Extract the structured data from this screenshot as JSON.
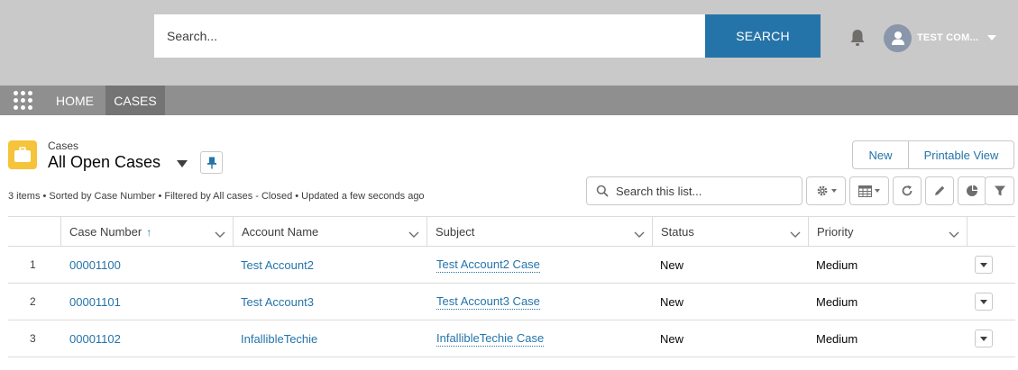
{
  "header": {
    "search_placeholder": "Search...",
    "search_button": "SEARCH",
    "user_name": "TEST COM...",
    "icons": {
      "notifications": "bell-icon",
      "avatar": "user-avatar-icon",
      "user_menu": "chevron-down-icon"
    }
  },
  "nav": {
    "launcher_icon": "app-launcher-icon",
    "items": [
      {
        "label": "HOME",
        "active": false
      },
      {
        "label": "CASES",
        "active": true
      }
    ]
  },
  "list": {
    "object_label": "Cases",
    "view_name": "All Open Cases",
    "meta": "3 items • Sorted by Case Number • Filtered by All cases - Closed • Updated a few seconds ago",
    "actions": {
      "new": "New",
      "printable_view": "Printable View"
    },
    "search_placeholder": "Search this list...",
    "toolbar_icons": [
      "settings-icon",
      "table-view-icon",
      "refresh-icon",
      "edit-icon",
      "chart-icon",
      "filter-icon"
    ]
  },
  "table": {
    "columns": [
      {
        "label": "Case Number",
        "sorted": "ascending"
      },
      {
        "label": "Account Name"
      },
      {
        "label": "Subject"
      },
      {
        "label": "Status"
      },
      {
        "label": "Priority"
      }
    ],
    "rows": [
      {
        "num": "1",
        "case_number": "00001100",
        "account": "Test Account2",
        "subject": "Test Account2 Case",
        "status": "New",
        "priority": "Medium"
      },
      {
        "num": "2",
        "case_number": "00001101",
        "account": "Test Account3",
        "subject": "Test Account3 Case",
        "status": "New",
        "priority": "Medium"
      },
      {
        "num": "3",
        "case_number": "00001102",
        "account": "InfallibleTechie",
        "subject": "InfallibleTechie Case",
        "status": "New",
        "priority": "Medium"
      }
    ]
  },
  "colors": {
    "header_bg": "#c9c9c9",
    "nav_bg": "#8f8f8f",
    "nav_active_bg": "#747474",
    "brand_blue": "#2574a9",
    "case_icon": "#f5c43a"
  }
}
